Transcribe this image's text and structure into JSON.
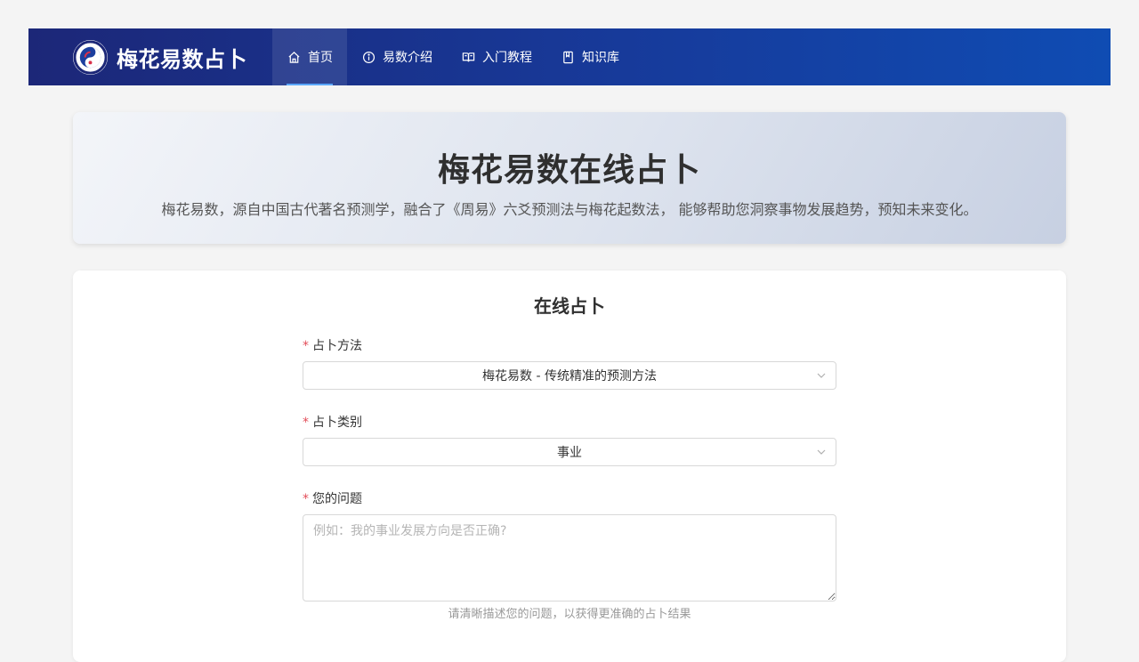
{
  "header": {
    "brand_title": "梅花易数占卜",
    "logo_icon": "yin-yang-logo-icon",
    "nav": [
      {
        "label": "首页",
        "icon": "home-icon",
        "active": true
      },
      {
        "label": "易数介绍",
        "icon": "info-circle-icon",
        "active": false
      },
      {
        "label": "入门教程",
        "icon": "book-open-icon",
        "active": false
      },
      {
        "label": "知识库",
        "icon": "bookmark-icon",
        "active": false
      }
    ],
    "colors": {
      "gradient_start": "#1c2778",
      "gradient_end": "#0f4cb3",
      "active_underline": "#5aa7ff"
    }
  },
  "hero": {
    "title": "梅花易数在线占卜",
    "description": "梅花易数，源自中国古代著名预测学，融合了《周易》六爻预测法与梅花起数法， 能够帮助您洞察事物发展趋势，预知未来变化。"
  },
  "form": {
    "title": "在线占卜",
    "method": {
      "label": "占卜方法",
      "value": "梅花易数 - 传统精准的预测方法"
    },
    "category": {
      "label": "占卜类别",
      "value": "事业"
    },
    "question": {
      "label": "您的问题",
      "placeholder": "例如：我的事业发展方向是否正确?",
      "hint": "请清晰描述您的问题，以获得更准确的占卜结果"
    },
    "required_mark": "*",
    "colors": {
      "required": "#e34d59"
    }
  }
}
